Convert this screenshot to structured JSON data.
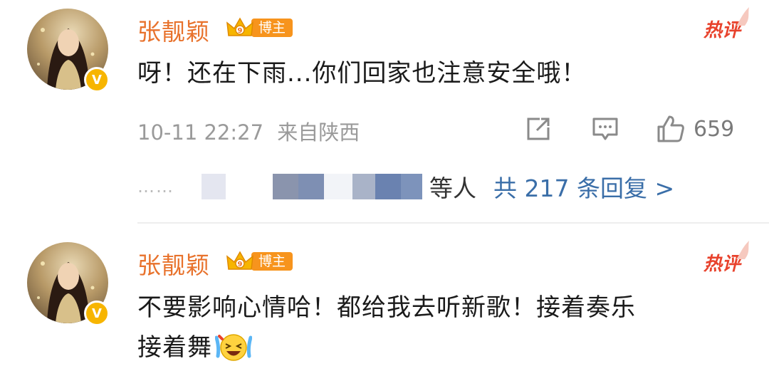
{
  "comments": [
    {
      "user": {
        "name": "张靓颖",
        "badge_label": "博主",
        "verified_mark": "V"
      },
      "hot_label": "热评",
      "text": "呀！还在下雨...你们回家也注意安全哦！",
      "time": "10-11 22:27",
      "source": "来自陕西",
      "likes": "659",
      "replies": {
        "dots": "……",
        "suffix": "等人",
        "total_label": "共 217 条回复 >"
      }
    },
    {
      "user": {
        "name": "张靓颖",
        "badge_label": "博主",
        "verified_mark": "V"
      },
      "hot_label": "热评",
      "text_line1": "不要影响心情哈！都给我去听新歌！接着奏乐",
      "text_line2": "接着舞"
    }
  ],
  "icons": {
    "share": "share-icon",
    "comment": "comment-icon",
    "like": "thumbs-up-icon",
    "emoji": "laughing-tears-emoji"
  },
  "colors": {
    "name": "#e8722c",
    "hot": "#e8422c",
    "link": "#3a6ea8",
    "badge": "#f7941d",
    "verified": "#f7b500"
  }
}
